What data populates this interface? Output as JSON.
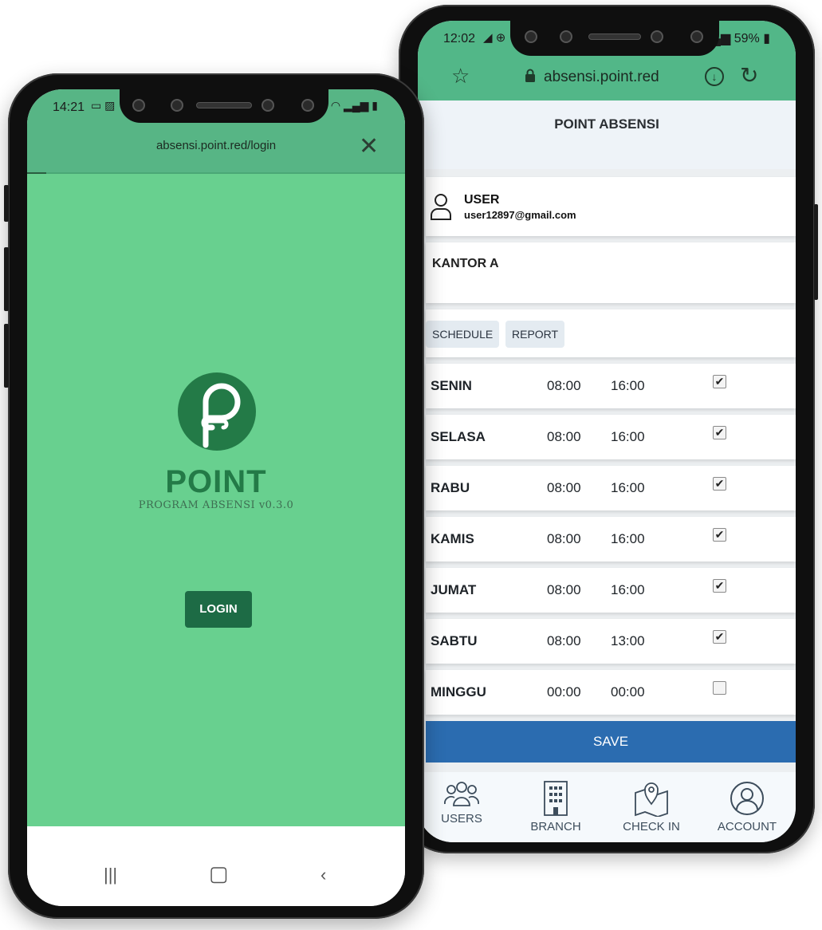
{
  "back_phone": {
    "status": {
      "time": "12:02",
      "battery": "59%"
    },
    "browser": {
      "url": "absensi.point.red"
    },
    "app": {
      "title": "POINT ABSENSI",
      "user": {
        "name": "USER",
        "email": "user12897@gmail.com"
      },
      "office": "KANTOR A",
      "tabs": [
        "SCHEDULE",
        "REPORT"
      ],
      "schedule": [
        {
          "day": "SENIN",
          "start": "08:00",
          "end": "16:00",
          "checked": true
        },
        {
          "day": "SELASA",
          "start": "08:00",
          "end": "16:00",
          "checked": true
        },
        {
          "day": "RABU",
          "start": "08:00",
          "end": "16:00",
          "checked": true
        },
        {
          "day": "KAMIS",
          "start": "08:00",
          "end": "16:00",
          "checked": true
        },
        {
          "day": "JUMAT",
          "start": "08:00",
          "end": "16:00",
          "checked": true
        },
        {
          "day": "SABTU",
          "start": "08:00",
          "end": "13:00",
          "checked": true
        },
        {
          "day": "MINGGU",
          "start": "00:00",
          "end": "00:00",
          "checked": false
        }
      ],
      "save_label": "SAVE",
      "nav": [
        {
          "label": "USERS",
          "icon": "users-icon"
        },
        {
          "label": "BRANCH",
          "icon": "building-icon"
        },
        {
          "label": "CHECK IN",
          "icon": "map-pin-icon"
        },
        {
          "label": "ACCOUNT",
          "icon": "account-icon"
        }
      ]
    }
  },
  "front_phone": {
    "status": {
      "time": "14:21"
    },
    "browser": {
      "url": "absensi.point.red/login"
    },
    "app": {
      "brand": "POINT",
      "tagline": "PROGRAM ABSENSI v0.3.0",
      "login_label": "LOGIN"
    }
  },
  "colors": {
    "header_green": "#52b788",
    "login_bg": "#68d08f",
    "brand_green": "#237a47",
    "save_blue": "#2b6cb0"
  }
}
